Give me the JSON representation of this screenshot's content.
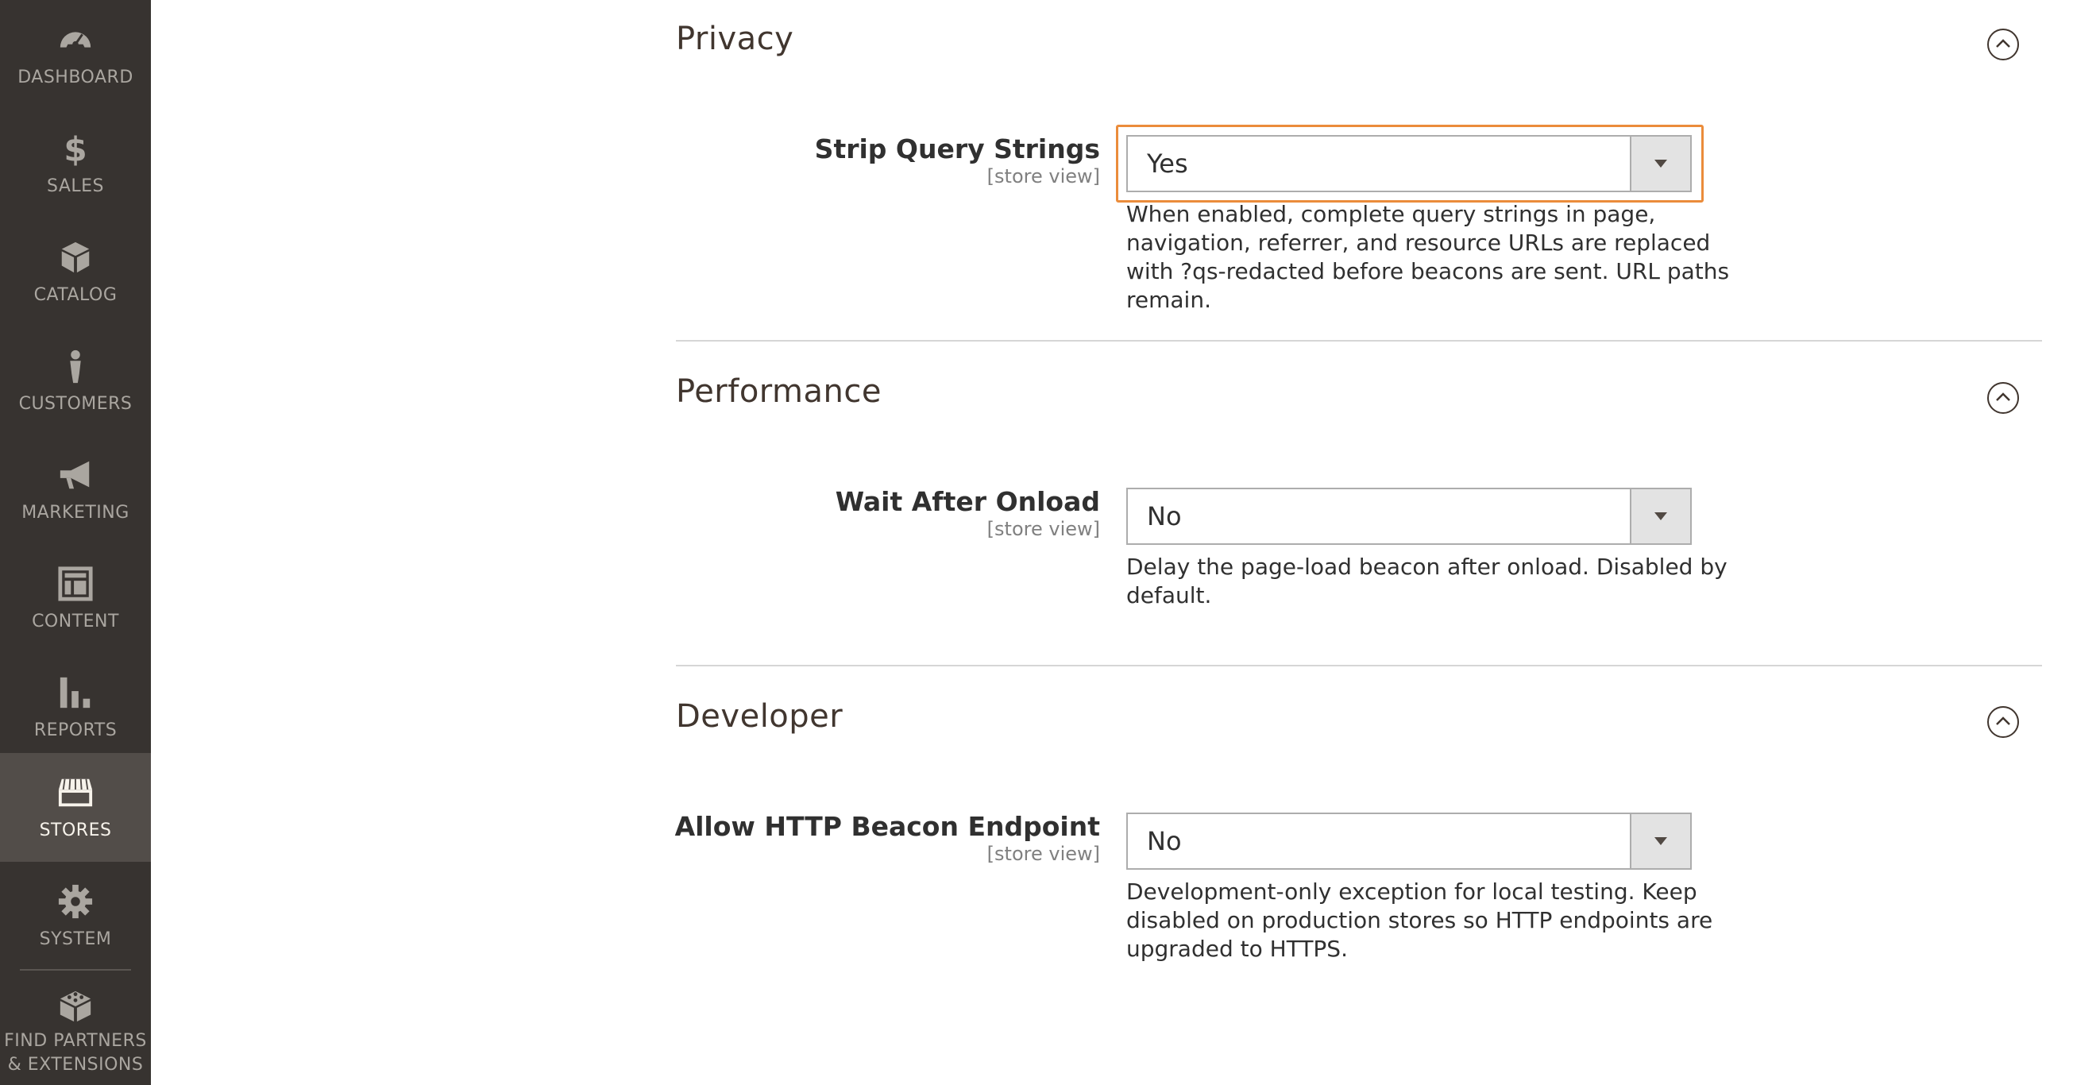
{
  "sidebar": {
    "items": [
      {
        "label": "DASHBOARD",
        "icon": "dashboard-icon"
      },
      {
        "label": "SALES",
        "icon": "dollar-icon"
      },
      {
        "label": "CATALOG",
        "icon": "box-icon"
      },
      {
        "label": "CUSTOMERS",
        "icon": "person-icon"
      },
      {
        "label": "MARKETING",
        "icon": "megaphone-icon"
      },
      {
        "label": "CONTENT",
        "icon": "layout-icon"
      },
      {
        "label": "REPORTS",
        "icon": "bar-chart-icon"
      },
      {
        "label": "STORES",
        "icon": "storefront-icon",
        "active": true
      },
      {
        "label": "SYSTEM",
        "icon": "gear-icon"
      },
      {
        "label": "FIND PARTNERS & EXTENSIONS",
        "icon": "blocks-icon"
      }
    ]
  },
  "sections": {
    "privacy": {
      "title": "Privacy",
      "field": {
        "label": "Strip Query Strings",
        "scope": "[store view]",
        "value": "Yes",
        "note": "When enabled, complete query strings in page, navigation, referrer, and resource URLs are replaced with ?qs-redacted before beacons are sent. URL paths remain."
      }
    },
    "performance": {
      "title": "Performance",
      "field": {
        "label": "Wait After Onload",
        "scope": "[store view]",
        "value": "No",
        "note": "Delay the page-load beacon after onload. Disabled by default."
      }
    },
    "developer": {
      "title": "Developer",
      "field": {
        "label": "Allow HTTP Beacon Endpoint",
        "scope": "[store view]",
        "value": "No",
        "note": "Development-only exception for local testing. Keep disabled on production stores so HTTP endpoints are upgraded to HTTPS."
      }
    }
  },
  "colors": {
    "sidebar_bg": "#373330",
    "sidebar_active_bg": "#524d49",
    "focus": "#eb8c3b"
  }
}
